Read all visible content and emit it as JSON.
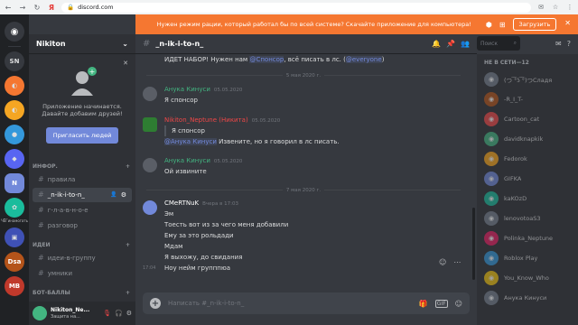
{
  "browser": {
    "url": "discord.com",
    "favicon_letter": "Я",
    "nav": [
      "←",
      "→",
      "↻"
    ]
  },
  "banner": {
    "text": "Нужен режим рации, который работал бы по всей системе? Скачайте приложение для компьютера!",
    "button": "Загрузить"
  },
  "guilds": [
    {
      "label": "SN",
      "color": "#36393f"
    },
    {
      "label": "",
      "color": "#f57731"
    },
    {
      "label": "",
      "color": "#f5a623"
    },
    {
      "label": "",
      "color": "#3498db"
    },
    {
      "label": "",
      "color": "#5865f2"
    },
    {
      "label": "N",
      "color": "#7289da"
    },
    {
      "label": "",
      "color": "#1abc9c"
    },
    {
      "label": "",
      "color": "#3f51b5"
    },
    {
      "label": "Dsa",
      "color": "#b4541a"
    },
    {
      "label": "MB",
      "color": "#c0392b"
    }
  ],
  "guild_caption": "ЧЁГинамогать",
  "server": {
    "name": "Nikiton"
  },
  "invite": {
    "text1": "Приложение начинается.",
    "text2": "Давайте добавим друзей!",
    "button": "Пригласить людей"
  },
  "categories": [
    {
      "name": "ИНФОР.",
      "channels": [
        "правила",
        "_n-ik-i-to-n_",
        "г-л-а-в-н-о-е",
        "разговор"
      ]
    },
    {
      "name": "ИДЕИ",
      "channels": [
        "идеи-в-группу",
        "умники"
      ]
    },
    {
      "name": "БОТ-БАЛЛЫ",
      "channels": []
    }
  ],
  "user": {
    "name": "Nikiton_Ne...",
    "status": "Защита на..."
  },
  "channel": {
    "name": "_n-ik-i-to-n_"
  },
  "search_placeholder": "Поиск",
  "chat": {
    "top_line": {
      "pre": "ИДЕТ НАБОР! Нужен нам ",
      "m1": "@Спонсор",
      "mid": ", всё писать в лс. (",
      "m2": "@everyone",
      "post": ")"
    },
    "date1": "5 мая 2020 г.",
    "m1": {
      "author": "Анука Кинуси",
      "time": "05.05.2020",
      "text": "Я спонсор",
      "color": "#43b581"
    },
    "m2": {
      "author": "Nikiton_Neptune (Никита)",
      "time": "05.05.2020",
      "quote": "Я спонсор",
      "mention": "@Анука Кинуси",
      "text": " Извените, но я говорил в лс писать.",
      "color": "#f04747"
    },
    "m3": {
      "author": "Анука Кинуси",
      "time": "05.05.2020",
      "text": "Ой извините",
      "color": "#43b581"
    },
    "date2": "7 мая 2020 г.",
    "m4": {
      "author": "CMeRTNuK",
      "time": "Вчера в 17:03",
      "lines": [
        "Эм",
        "Тоесть вот из за чего меня добавили",
        "Ему за это рольдади",
        "Мдам",
        "Я выхожу, до свидания",
        "Ноу нейм групппюа"
      ],
      "color": "#ffffff",
      "last_time": "17:04"
    }
  },
  "composer": {
    "placeholder": "Написать #_n-ik-i-to-n_"
  },
  "members": {
    "category": "НЕ В СЕТИ—12",
    "list": [
      "(つ ͡°ʖ ͡°)つСладя",
      "-R_I_T-",
      "Cartoon_cat",
      "davidknapkik",
      "Fedorok",
      "GIFKA",
      "kaKOzD",
      "lenovotoaS3",
      "Polinka_Neptune",
      "Roblox Play",
      "You_Know_Who",
      "Анука Кинуси"
    ]
  }
}
